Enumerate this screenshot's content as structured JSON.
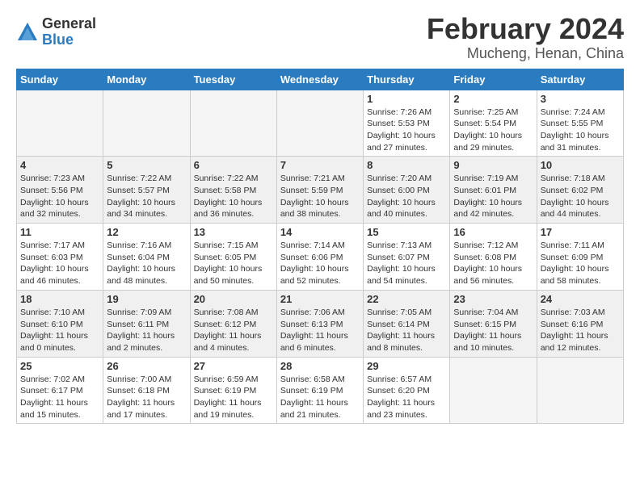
{
  "logo": {
    "general": "General",
    "blue": "Blue"
  },
  "title": "February 2024",
  "subtitle": "Mucheng, Henan, China",
  "days_header": [
    "Sunday",
    "Monday",
    "Tuesday",
    "Wednesday",
    "Thursday",
    "Friday",
    "Saturday"
  ],
  "weeks": [
    [
      {
        "day": "",
        "info": ""
      },
      {
        "day": "",
        "info": ""
      },
      {
        "day": "",
        "info": ""
      },
      {
        "day": "",
        "info": ""
      },
      {
        "day": "1",
        "info": "Sunrise: 7:26 AM\nSunset: 5:53 PM\nDaylight: 10 hours\nand 27 minutes."
      },
      {
        "day": "2",
        "info": "Sunrise: 7:25 AM\nSunset: 5:54 PM\nDaylight: 10 hours\nand 29 minutes."
      },
      {
        "day": "3",
        "info": "Sunrise: 7:24 AM\nSunset: 5:55 PM\nDaylight: 10 hours\nand 31 minutes."
      }
    ],
    [
      {
        "day": "4",
        "info": "Sunrise: 7:23 AM\nSunset: 5:56 PM\nDaylight: 10 hours\nand 32 minutes."
      },
      {
        "day": "5",
        "info": "Sunrise: 7:22 AM\nSunset: 5:57 PM\nDaylight: 10 hours\nand 34 minutes."
      },
      {
        "day": "6",
        "info": "Sunrise: 7:22 AM\nSunset: 5:58 PM\nDaylight: 10 hours\nand 36 minutes."
      },
      {
        "day": "7",
        "info": "Sunrise: 7:21 AM\nSunset: 5:59 PM\nDaylight: 10 hours\nand 38 minutes."
      },
      {
        "day": "8",
        "info": "Sunrise: 7:20 AM\nSunset: 6:00 PM\nDaylight: 10 hours\nand 40 minutes."
      },
      {
        "day": "9",
        "info": "Sunrise: 7:19 AM\nSunset: 6:01 PM\nDaylight: 10 hours\nand 42 minutes."
      },
      {
        "day": "10",
        "info": "Sunrise: 7:18 AM\nSunset: 6:02 PM\nDaylight: 10 hours\nand 44 minutes."
      }
    ],
    [
      {
        "day": "11",
        "info": "Sunrise: 7:17 AM\nSunset: 6:03 PM\nDaylight: 10 hours\nand 46 minutes."
      },
      {
        "day": "12",
        "info": "Sunrise: 7:16 AM\nSunset: 6:04 PM\nDaylight: 10 hours\nand 48 minutes."
      },
      {
        "day": "13",
        "info": "Sunrise: 7:15 AM\nSunset: 6:05 PM\nDaylight: 10 hours\nand 50 minutes."
      },
      {
        "day": "14",
        "info": "Sunrise: 7:14 AM\nSunset: 6:06 PM\nDaylight: 10 hours\nand 52 minutes."
      },
      {
        "day": "15",
        "info": "Sunrise: 7:13 AM\nSunset: 6:07 PM\nDaylight: 10 hours\nand 54 minutes."
      },
      {
        "day": "16",
        "info": "Sunrise: 7:12 AM\nSunset: 6:08 PM\nDaylight: 10 hours\nand 56 minutes."
      },
      {
        "day": "17",
        "info": "Sunrise: 7:11 AM\nSunset: 6:09 PM\nDaylight: 10 hours\nand 58 minutes."
      }
    ],
    [
      {
        "day": "18",
        "info": "Sunrise: 7:10 AM\nSunset: 6:10 PM\nDaylight: 11 hours\nand 0 minutes."
      },
      {
        "day": "19",
        "info": "Sunrise: 7:09 AM\nSunset: 6:11 PM\nDaylight: 11 hours\nand 2 minutes."
      },
      {
        "day": "20",
        "info": "Sunrise: 7:08 AM\nSunset: 6:12 PM\nDaylight: 11 hours\nand 4 minutes."
      },
      {
        "day": "21",
        "info": "Sunrise: 7:06 AM\nSunset: 6:13 PM\nDaylight: 11 hours\nand 6 minutes."
      },
      {
        "day": "22",
        "info": "Sunrise: 7:05 AM\nSunset: 6:14 PM\nDaylight: 11 hours\nand 8 minutes."
      },
      {
        "day": "23",
        "info": "Sunrise: 7:04 AM\nSunset: 6:15 PM\nDaylight: 11 hours\nand 10 minutes."
      },
      {
        "day": "24",
        "info": "Sunrise: 7:03 AM\nSunset: 6:16 PM\nDaylight: 11 hours\nand 12 minutes."
      }
    ],
    [
      {
        "day": "25",
        "info": "Sunrise: 7:02 AM\nSunset: 6:17 PM\nDaylight: 11 hours\nand 15 minutes."
      },
      {
        "day": "26",
        "info": "Sunrise: 7:00 AM\nSunset: 6:18 PM\nDaylight: 11 hours\nand 17 minutes."
      },
      {
        "day": "27",
        "info": "Sunrise: 6:59 AM\nSunset: 6:19 PM\nDaylight: 11 hours\nand 19 minutes."
      },
      {
        "day": "28",
        "info": "Sunrise: 6:58 AM\nSunset: 6:19 PM\nDaylight: 11 hours\nand 21 minutes."
      },
      {
        "day": "29",
        "info": "Sunrise: 6:57 AM\nSunset: 6:20 PM\nDaylight: 11 hours\nand 23 minutes."
      },
      {
        "day": "",
        "info": ""
      },
      {
        "day": "",
        "info": ""
      }
    ]
  ]
}
